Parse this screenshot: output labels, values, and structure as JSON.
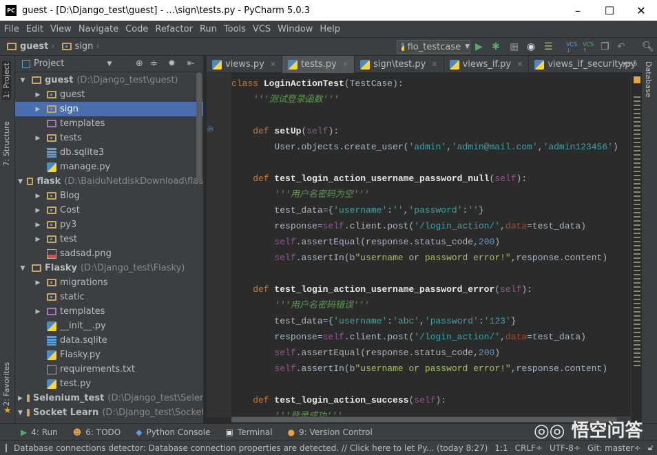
{
  "window": {
    "title": "guest - [D:\\Django_test\\guest] - ...\\sign\\tests.py - PyCharm 5.0.3",
    "app_icon": "PC"
  },
  "menu": [
    "File",
    "Edit",
    "View",
    "Navigate",
    "Code",
    "Refactor",
    "Run",
    "Tools",
    "VCS",
    "Window",
    "Help"
  ],
  "breadcrumb": [
    "guest",
    "sign"
  ],
  "run_config": "fio_testcase",
  "toolwindows_left": {
    "project": "1: Project",
    "structure": "7: Structure",
    "favorites": "2: Favorites"
  },
  "toolwindows_right": {
    "database": "Database"
  },
  "project_panel": {
    "title": "Project",
    "tree": [
      {
        "level": 0,
        "expanded": true,
        "icon": "folder",
        "name": "guest",
        "path": "(D:\\Django_test\\guest)",
        "bold": true
      },
      {
        "level": 1,
        "expanded": false,
        "icon": "folder-module",
        "name": "guest"
      },
      {
        "level": 1,
        "expanded": false,
        "icon": "folder-module",
        "name": "sign",
        "selected": true
      },
      {
        "level": 1,
        "icon": "folder-templates",
        "name": "templates"
      },
      {
        "level": 1,
        "expanded": false,
        "icon": "folder-module",
        "name": "tests"
      },
      {
        "level": 1,
        "icon": "database-file",
        "name": "db.sqlite3"
      },
      {
        "level": 1,
        "icon": "python-file",
        "name": "manage.py"
      },
      {
        "level": 0,
        "expanded": true,
        "icon": "folder",
        "name": "flask",
        "path": "(D:\\BaiduNetdiskDownload\\flas",
        "bold": true
      },
      {
        "level": 1,
        "expanded": false,
        "icon": "folder-module",
        "name": "Blog"
      },
      {
        "level": 1,
        "expanded": false,
        "icon": "folder-module",
        "name": "Cost"
      },
      {
        "level": 1,
        "expanded": false,
        "icon": "folder-module",
        "name": "py3"
      },
      {
        "level": 1,
        "expanded": false,
        "icon": "folder-module",
        "name": "test"
      },
      {
        "level": 1,
        "icon": "image-file",
        "name": "sadsad.png"
      },
      {
        "level": 0,
        "expanded": true,
        "icon": "folder",
        "name": "Flasky",
        "path": "(D:\\Django_test\\Flasky)",
        "bold": true
      },
      {
        "level": 1,
        "expanded": false,
        "icon": "folder-module",
        "name": "migrations"
      },
      {
        "level": 1,
        "icon": "folder-module",
        "name": "static"
      },
      {
        "level": 1,
        "expanded": false,
        "icon": "folder-templates",
        "name": "templates"
      },
      {
        "level": 1,
        "icon": "python-file",
        "name": "__init__.py"
      },
      {
        "level": 1,
        "icon": "database-file",
        "name": "data.sqlite"
      },
      {
        "level": 1,
        "icon": "python-file",
        "name": "Flasky.py"
      },
      {
        "level": 1,
        "icon": "text-file",
        "name": "requirements.txt"
      },
      {
        "level": 1,
        "icon": "python-file",
        "name": "test.py"
      },
      {
        "level": 0,
        "expanded": false,
        "icon": "folder",
        "name": "Selenium_test",
        "path": "(D:\\Django_test\\Seleni",
        "bold": true
      },
      {
        "level": 0,
        "expanded": true,
        "icon": "folder",
        "name": "Socket Learn",
        "path": "(D:\\Django_test\\Socket",
        "bold": true
      }
    ]
  },
  "tabs": [
    {
      "label": "views.py"
    },
    {
      "label": "tests.py",
      "active": true
    },
    {
      "label": "sign\\test.py"
    },
    {
      "label": "views_if.py"
    },
    {
      "label": "views_if_security.py"
    }
  ],
  "tabs_overflow": "5",
  "code": [
    [
      [
        "class ",
        "kw"
      ],
      [
        "LoginActionTest",
        "fn"
      ],
      [
        "(TestCase):",
        ""
      ]
    ],
    [
      [
        "    '''测试登录函数'''",
        "doc"
      ]
    ],
    [],
    [
      [
        "    def ",
        "kw"
      ],
      [
        "setUp",
        "fn"
      ],
      [
        "(",
        ""
      ],
      [
        "self",
        "slf"
      ],
      [
        "):",
        ""
      ]
    ],
    [
      [
        "        User.objects.create_user(",
        ""
      ],
      [
        "'admin'",
        "str"
      ],
      [
        ",",
        ""
      ],
      [
        "'admin@mail.com'",
        "str"
      ],
      [
        ",",
        ""
      ],
      [
        "'admin123456'",
        "str"
      ],
      [
        ")",
        ""
      ]
    ],
    [],
    [
      [
        "    def ",
        "kw"
      ],
      [
        "test_login_action_username_password_null",
        "fn"
      ],
      [
        "(",
        ""
      ],
      [
        "self",
        "slf"
      ],
      [
        "):",
        ""
      ]
    ],
    [
      [
        "        '''用户名密码为空'''",
        "doc"
      ]
    ],
    [
      [
        "        test_data={",
        ""
      ],
      [
        "'username'",
        "str"
      ],
      [
        ":",
        ""
      ],
      [
        "''",
        "str"
      ],
      [
        ",",
        ""
      ],
      [
        "'password'",
        "str"
      ],
      [
        ":",
        ""
      ],
      [
        "''",
        "str"
      ],
      [
        "}",
        ""
      ]
    ],
    [
      [
        "        response=",
        ""
      ],
      [
        "self",
        "slf"
      ],
      [
        ".client.post(",
        ""
      ],
      [
        "'/login_action/'",
        "str"
      ],
      [
        ",",
        ""
      ],
      [
        "data",
        "kwa"
      ],
      [
        "=test_data)",
        ""
      ]
    ],
    [
      [
        "        ",
        ""
      ],
      [
        "self",
        "slf"
      ],
      [
        ".assertEqual(response.status_code,",
        ""
      ],
      [
        "200",
        "num"
      ],
      [
        ")",
        ""
      ]
    ],
    [
      [
        "        ",
        ""
      ],
      [
        "self",
        "slf"
      ],
      [
        ".assertIn(b",
        ""
      ],
      [
        "\"username or password error!\"",
        "bstr"
      ],
      [
        ",response.content)",
        ""
      ]
    ],
    [],
    [
      [
        "    def ",
        "kw"
      ],
      [
        "test_login_action_username_password_error",
        "fn"
      ],
      [
        "(",
        ""
      ],
      [
        "self",
        "slf"
      ],
      [
        "):",
        ""
      ]
    ],
    [
      [
        "        '''用户名密码错误'''",
        "doc"
      ]
    ],
    [
      [
        "        test_data={",
        ""
      ],
      [
        "'username'",
        "str"
      ],
      [
        ":",
        ""
      ],
      [
        "'abc'",
        "str"
      ],
      [
        ",",
        ""
      ],
      [
        "'password'",
        "str"
      ],
      [
        ":",
        ""
      ],
      [
        "'123'",
        "str"
      ],
      [
        "}",
        ""
      ]
    ],
    [
      [
        "        response=",
        ""
      ],
      [
        "self",
        "slf"
      ],
      [
        ".client.post(",
        ""
      ],
      [
        "'/login_action/'",
        "str"
      ],
      [
        ",",
        ""
      ],
      [
        "data",
        "kwa"
      ],
      [
        "=test_data)",
        ""
      ]
    ],
    [
      [
        "        ",
        ""
      ],
      [
        "self",
        "slf"
      ],
      [
        ".assertEqual(response.status_code,",
        ""
      ],
      [
        "200",
        "num"
      ],
      [
        ")",
        ""
      ]
    ],
    [
      [
        "        ",
        ""
      ],
      [
        "self",
        "slf"
      ],
      [
        ".assertIn(b",
        ""
      ],
      [
        "\"username or password error!\"",
        "bstr"
      ],
      [
        ",response.content)",
        ""
      ]
    ],
    [],
    [
      [
        "    def ",
        "kw"
      ],
      [
        "test_login_action_success",
        "fn"
      ],
      [
        "(",
        ""
      ],
      [
        "self",
        "slf"
      ],
      [
        "):",
        ""
      ]
    ],
    [
      [
        "        '''登录成功'''",
        "doc"
      ]
    ]
  ],
  "bottom_tools": [
    {
      "label": "4: Run",
      "icon": "run-icon"
    },
    {
      "label": "6: TODO",
      "icon": "todo-icon"
    },
    {
      "label": "Python Console",
      "icon": "python-console-icon"
    },
    {
      "label": "Terminal",
      "icon": "terminal-icon"
    },
    {
      "label": "9: Version Control",
      "icon": "vcs-icon"
    }
  ],
  "status": {
    "message": "Database connections detector: Database connection properties are detected. // Click here to let Py... (today 8:27)",
    "position": "1:1",
    "line_sep": "CRLF÷",
    "encoding": "UTF-8÷",
    "git": "Git: master÷"
  },
  "watermark": "悟空问答",
  "colors": {
    "selection": "#4b6eaf",
    "keyword": "#cc7832",
    "string": "#3fa3a3",
    "docstring": "#629755",
    "self": "#94558d",
    "number": "#6897bb"
  }
}
